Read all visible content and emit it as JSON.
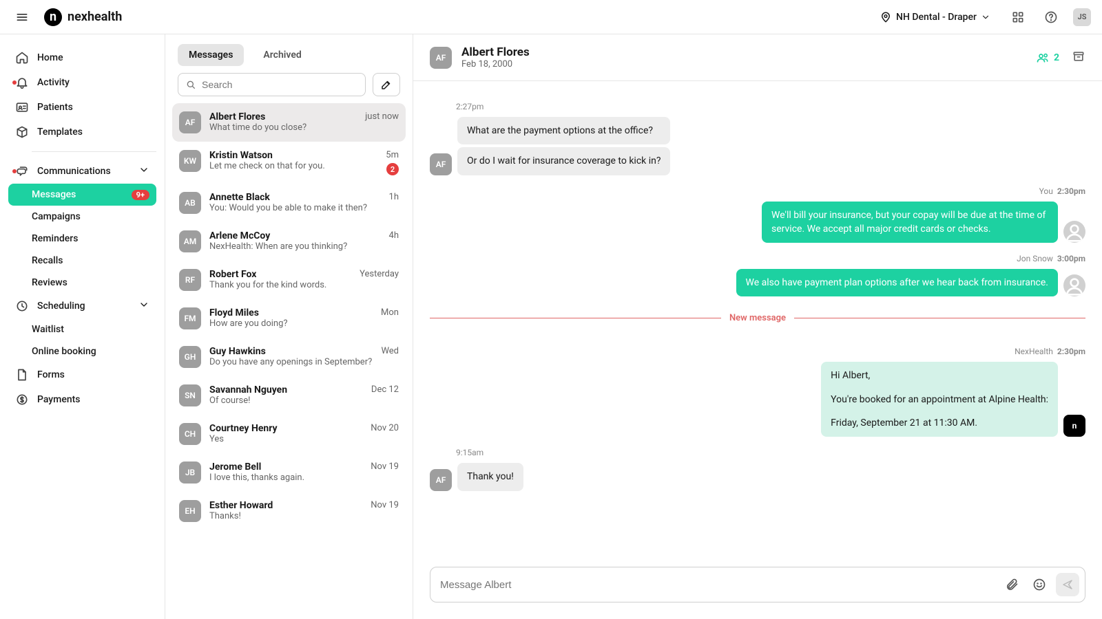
{
  "brand": "nexhealth",
  "location": "NH Dental - Draper",
  "user_initials": "JS",
  "nav": {
    "home": "Home",
    "activity": "Activity",
    "patients": "Patients",
    "templates": "Templates",
    "communications": "Communications",
    "messages": "Messages",
    "messages_badge": "9+",
    "campaigns": "Campaigns",
    "reminders": "Reminders",
    "recalls": "Recalls",
    "reviews": "Reviews",
    "scheduling": "Scheduling",
    "waitlist": "Waitlist",
    "online_booking": "Online booking",
    "forms": "Forms",
    "payments": "Payments"
  },
  "tabs": {
    "messages": "Messages",
    "archived": "Archived"
  },
  "search_placeholder": "Search",
  "convos": [
    {
      "initials": "AF",
      "name": "Albert Flores",
      "preview": "What time do you close?",
      "time": "just now",
      "selected": true
    },
    {
      "initials": "KW",
      "name": "Kristin Watson",
      "preview": "Let me check on that for you.",
      "time": "5m",
      "unread": "2"
    },
    {
      "initials": "AB",
      "name": "Annette Black",
      "preview": "You: Would you be able to make it then?",
      "time": "1h"
    },
    {
      "initials": "AM",
      "name": "Arlene McCoy",
      "preview": "NexHealth: When are you thinking?",
      "time": "4h"
    },
    {
      "initials": "RF",
      "name": "Robert Fox",
      "preview": "Thank you for the kind words.",
      "time": "Yesterday"
    },
    {
      "initials": "FM",
      "name": "Floyd Miles",
      "preview": "How are you doing?",
      "time": "Mon"
    },
    {
      "initials": "GH",
      "name": "Guy Hawkins",
      "preview": "Do you have any openings in September?",
      "time": "Wed"
    },
    {
      "initials": "SN",
      "name": "Savannah Nguyen",
      "preview": "Of course!",
      "time": "Dec 12"
    },
    {
      "initials": "CH",
      "name": "Courtney Henry",
      "preview": "Yes",
      "time": "Nov 20"
    },
    {
      "initials": "JB",
      "name": "Jerome Bell",
      "preview": "I love this, thanks again.",
      "time": "Nov 19"
    },
    {
      "initials": "EH",
      "name": "Esther Howard",
      "preview": "Thanks!",
      "time": "Nov 19"
    }
  ],
  "chat": {
    "header": {
      "initials": "AF",
      "name": "Albert Flores",
      "dob": "Feb 18, 2000",
      "family_count": "2"
    },
    "groups": {
      "g1_time": "2:27pm",
      "g1_m1": "What are the payment options at the office?",
      "g1_m2": "Or do I wait for insurance coverage to kick in?",
      "g2_sender": "You",
      "g2_time": "2:30pm",
      "g2_m1": "We'll bill your insurance, but your copay will be due at the time of service. We accept all major credit cards or checks.",
      "g3_sender": "Jon Snow",
      "g3_time": "3:00pm",
      "g3_m1": "We also have payment plan options after we hear back from insurance.",
      "divider": "New message",
      "g4_sender": "NexHealth",
      "g4_time": "2:30pm",
      "g4_l1": "Hi Albert,",
      "g4_l2": "You're booked for an appointment at Alpine Health:",
      "g4_l3": "Friday, September 21 at 11:30 AM.",
      "g5_time": "9:15am",
      "g5_m1": "Thank you!"
    },
    "composer_placeholder": "Message Albert"
  }
}
